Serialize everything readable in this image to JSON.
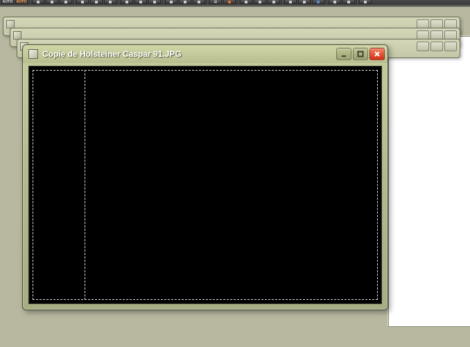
{
  "toolbar": {
    "auto_off_label": "AUTO",
    "auto_on_label": "AUTO"
  },
  "window": {
    "title": "Copie de Holsteiner Caspar 91.JPG"
  },
  "icons": {
    "app": "image-icon",
    "minimize": "minimize-icon",
    "maximize": "maximize-icon",
    "close": "close-icon"
  }
}
